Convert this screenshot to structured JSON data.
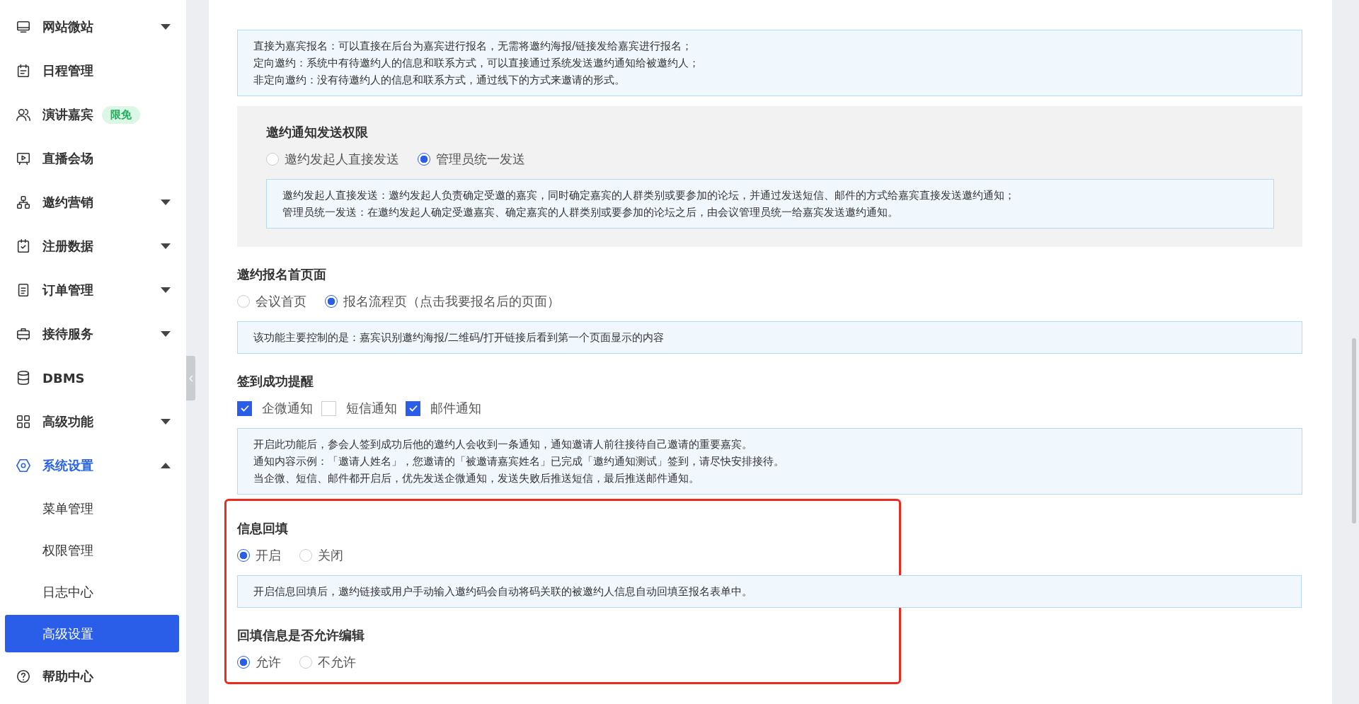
{
  "sidebar": {
    "items": [
      {
        "label": "网站微站",
        "expanded": false,
        "selected": false
      },
      {
        "label": "日程管理",
        "selected": false
      },
      {
        "label": "演讲嘉宾",
        "badge": "限免",
        "selected": false
      },
      {
        "label": "直播会场",
        "selected": false
      },
      {
        "label": "邀约营销",
        "expanded": false,
        "selected": false
      },
      {
        "label": "注册数据",
        "expanded": false,
        "selected": false
      },
      {
        "label": "订单管理",
        "expanded": false,
        "selected": false
      },
      {
        "label": "接待服务",
        "expanded": false,
        "selected": false
      },
      {
        "label": "DBMS",
        "selected": false
      },
      {
        "label": "高级功能",
        "expanded": false,
        "selected": false
      },
      {
        "label": "系统设置",
        "expanded": true,
        "selected": false,
        "children": [
          {
            "label": "菜单管理",
            "selected": false
          },
          {
            "label": "权限管理",
            "selected": false
          },
          {
            "label": "日志中心",
            "selected": false
          },
          {
            "label": "高级设置",
            "selected": true
          }
        ]
      },
      {
        "label": "帮助中心",
        "selected": false
      }
    ]
  },
  "intro_note": [
    "直接为嘉宾报名：可以直接在后台为嘉宾进行报名，无需将邀约海报/链接发给嘉宾进行报名；",
    "定向邀约：系统中有待邀约人的信息和联系方式，可以直接通过系统发送邀约通知给被邀约人；",
    "非定向邀约：没有待邀约人的信息和联系方式，通过线下的方式来邀请的形式。"
  ],
  "sections": [
    {
      "title": "邀约通知发送权限",
      "kind": "radio",
      "shaded": true,
      "highlighted": false,
      "options": [
        {
          "label": "邀约发起人直接发送",
          "selected": false
        },
        {
          "label": "管理员统一发送",
          "selected": true
        }
      ],
      "note": [
        "邀约发起人直接发送：邀约发起人负责确定受邀的嘉宾，同时确定嘉宾的人群类别或要参加的论坛，并通过发送短信、邮件的方式给嘉宾直接发送邀约通知；",
        "管理员统一发送：在邀约发起人确定受邀嘉宾、确定嘉宾的人群类别或要参加的论坛之后，由会议管理员统一给嘉宾发送邀约通知。"
      ]
    },
    {
      "title": "邀约报名首页面",
      "kind": "radio",
      "shaded": false,
      "highlighted": false,
      "options": [
        {
          "label": "会议首页",
          "selected": false
        },
        {
          "label": "报名流程页（点击我要报名后的页面）",
          "selected": true
        }
      ],
      "note": [
        "该功能主要控制的是：嘉宾识别邀约海报/二维码/打开链接后看到第一个页面显示的内容"
      ]
    },
    {
      "title": "签到成功提醒",
      "kind": "checkbox",
      "shaded": false,
      "highlighted": false,
      "options": [
        {
          "label": "企微通知",
          "checked": true
        },
        {
          "label": "短信通知",
          "checked": false
        },
        {
          "label": "邮件通知",
          "checked": true
        }
      ],
      "note": [
        "开启此功能后，参会人签到成功后他的邀约人会收到一条通知，通知邀请人前往接待自己邀请的重要嘉宾。",
        "通知内容示例：「邀请人姓名」，您邀请的「被邀请嘉宾姓名」已完成「邀约通知测试」签到，请尽快安排接待。",
        "当企微、短信、邮件都开启后，优先发送企微通知，发送失败后推送短信，最后推送邮件通知。"
      ]
    },
    {
      "title": "信息回填",
      "kind": "radio",
      "shaded": false,
      "highlighted": true,
      "options": [
        {
          "label": "开启",
          "selected": true
        },
        {
          "label": "关闭",
          "selected": false
        }
      ],
      "note": [
        "开启信息回填后，邀约链接或用户手动输入邀约码会自动将码关联的被邀约人信息自动回填至报名表单中。"
      ]
    },
    {
      "title": "回填信息是否允许编辑",
      "kind": "radio",
      "shaded": false,
      "highlighted": true,
      "options": [
        {
          "label": "允许",
          "selected": true
        },
        {
          "label": "不允许",
          "selected": false
        }
      ]
    }
  ]
}
